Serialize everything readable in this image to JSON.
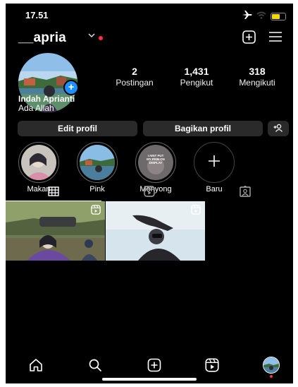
{
  "status_bar": {
    "time": "17.51",
    "battery_level": 0.6
  },
  "header": {
    "username": "__apria",
    "chevron": "chevron-down-icon",
    "new_post_icon": "plus-square-icon",
    "menu_icon": "menu-icon"
  },
  "profile": {
    "stats": [
      {
        "value": "2",
        "label": "Postingan"
      },
      {
        "value": "1,431",
        "label": "Pengikut"
      },
      {
        "value": "318",
        "label": "Mengikuti"
      }
    ],
    "name": "Indah Aprianti",
    "bio": "Ada Allah"
  },
  "buttons": {
    "edit": "Edit profil",
    "share": "Bagikan profil",
    "discover_icon": "add-person-icon"
  },
  "highlights": [
    {
      "label": "Makan"
    },
    {
      "label": "Pink"
    },
    {
      "label": "Monyong",
      "overlay_text": "I AINT PUT\nMY PAIN ON\nDISPLAY"
    },
    {
      "label": "Baru"
    }
  ],
  "tabs": [
    "grid-icon",
    "reels-icon",
    "tagged-icon"
  ],
  "nav": [
    "home-icon",
    "search-icon",
    "create-icon",
    "reels-icon",
    "profile-avatar"
  ],
  "colors": {
    "accent": "#1f8fff",
    "notification": "#ff3040",
    "button_bg": "#2a2a2a"
  }
}
